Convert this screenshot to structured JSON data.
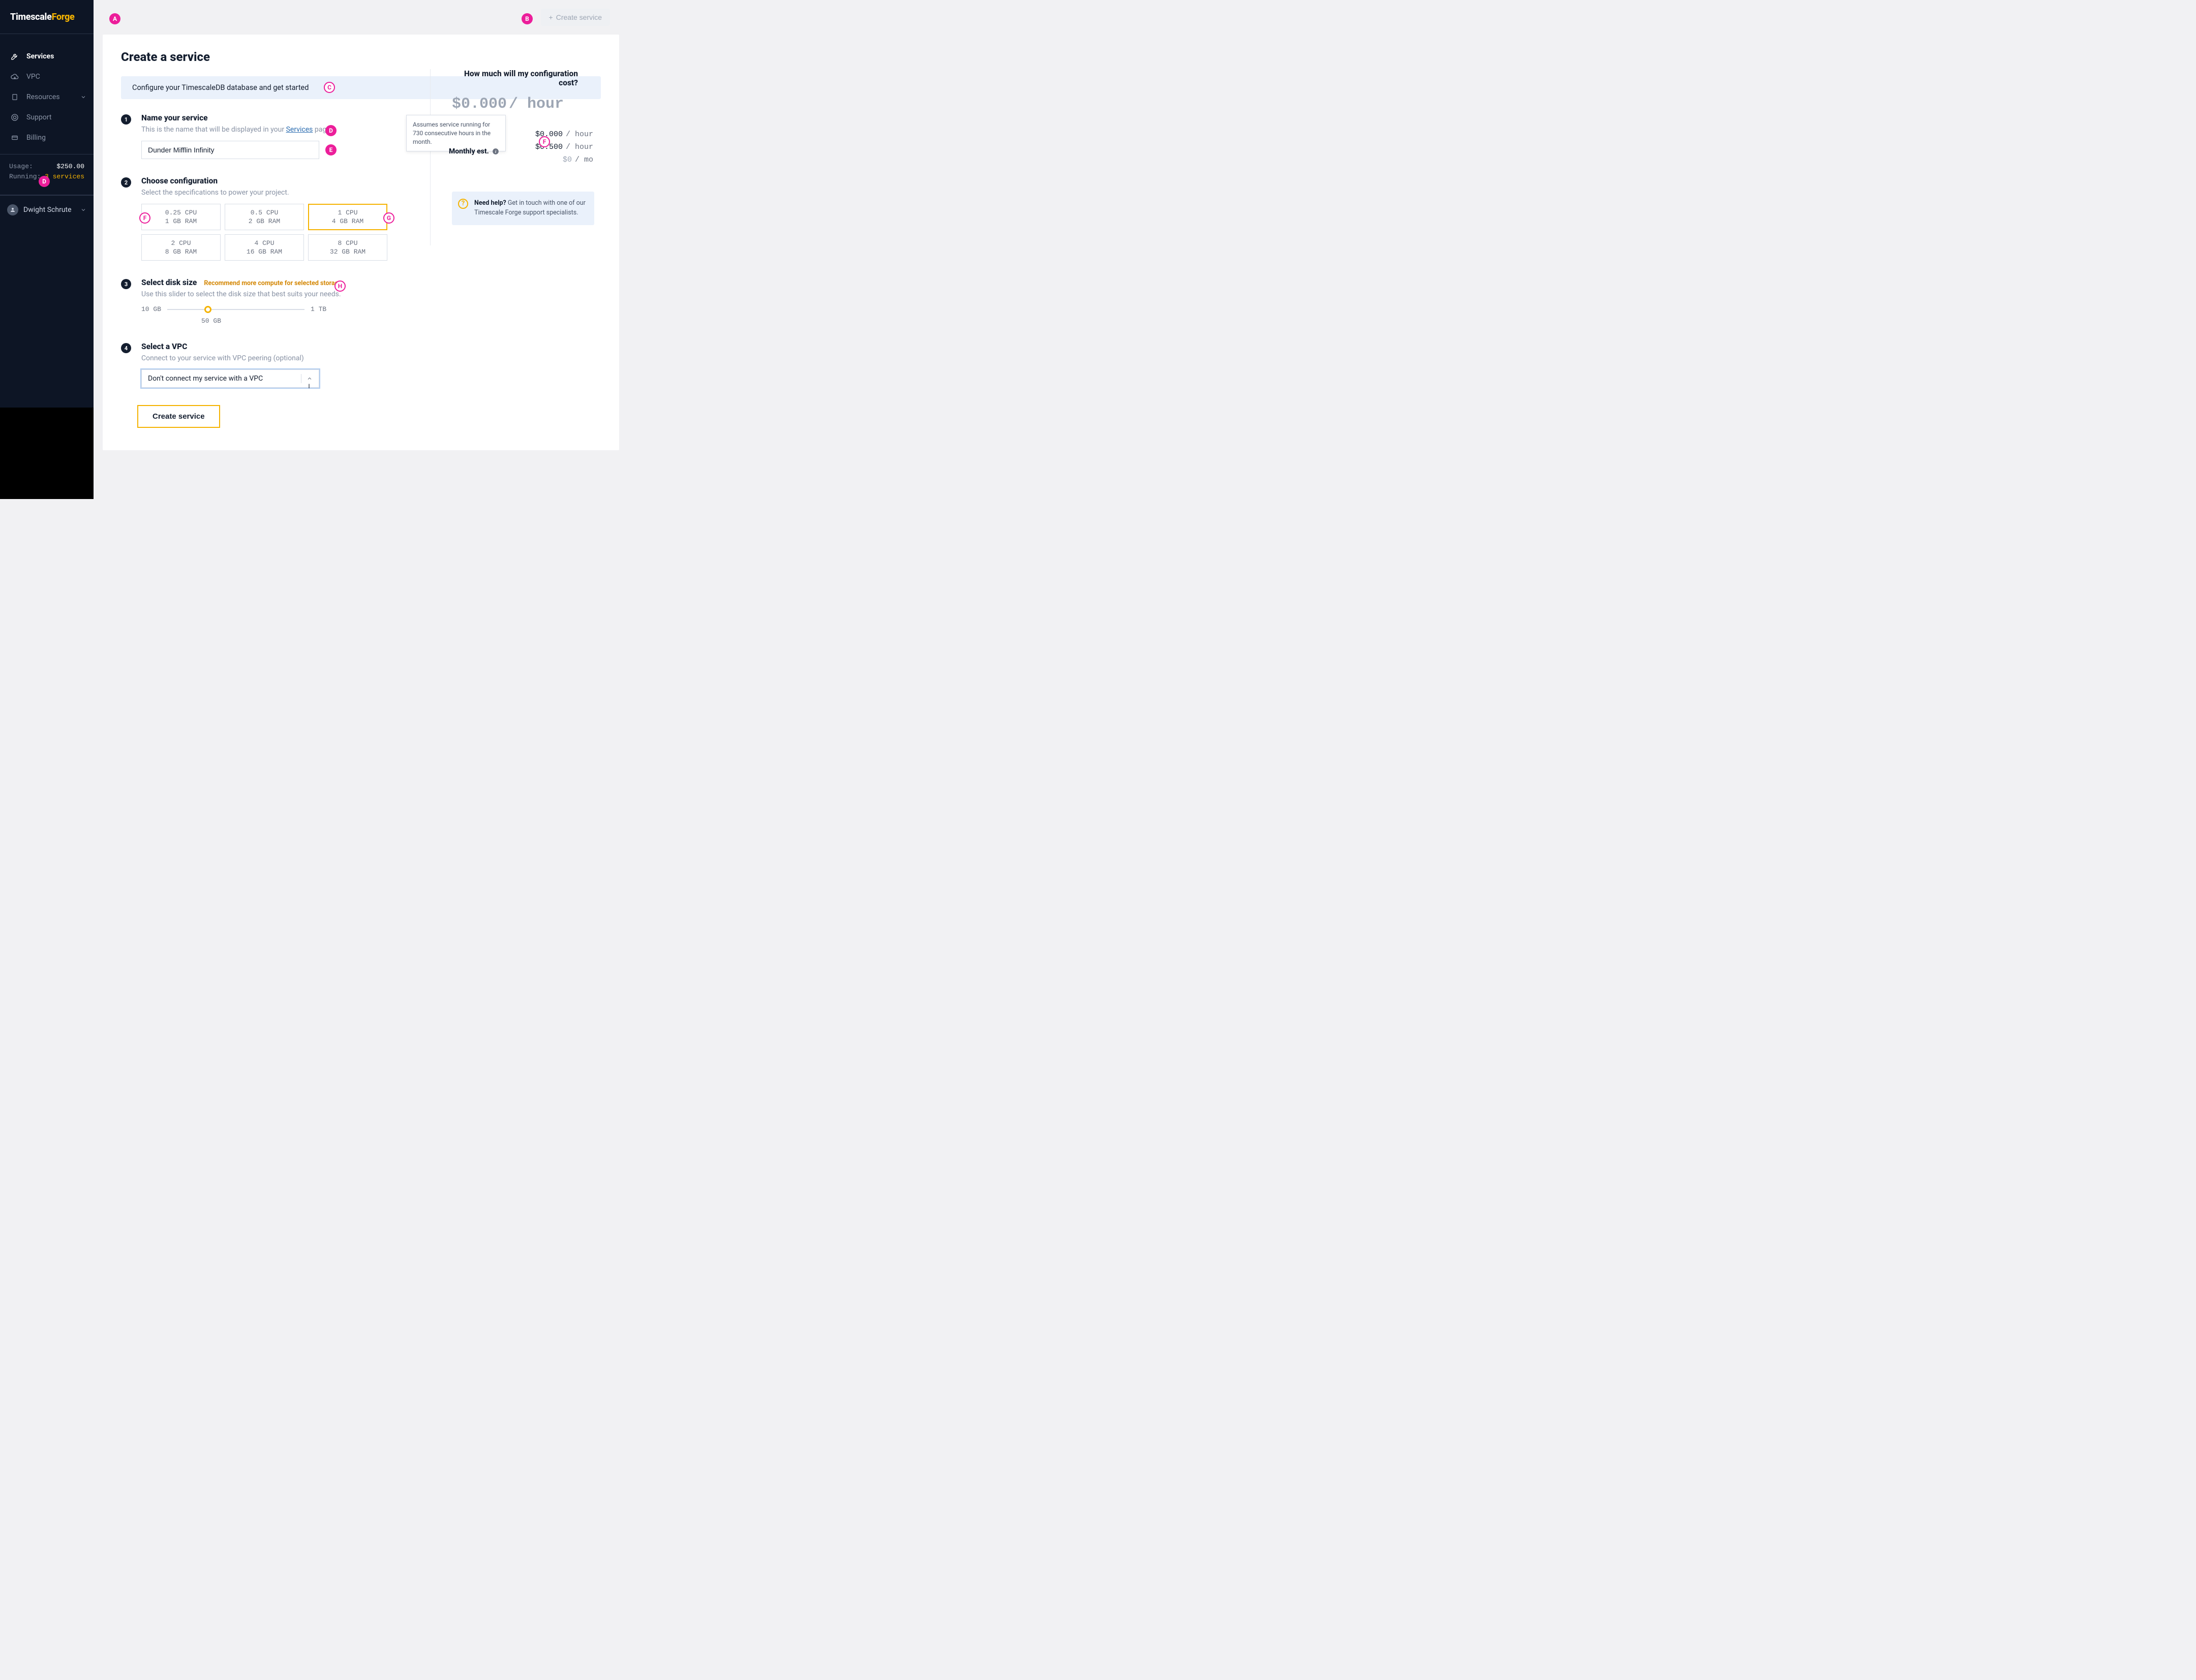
{
  "brand": {
    "part1": "Timescale",
    "part2": "Forge"
  },
  "sidebar": {
    "items": [
      {
        "label": "Services",
        "active": true
      },
      {
        "label": "VPC"
      },
      {
        "label": "Resources",
        "expandable": true
      },
      {
        "label": "Support"
      },
      {
        "label": "Billing"
      }
    ],
    "usage": {
      "label": "Usage:",
      "value": "$250.00",
      "running_label": "Running:",
      "running_value": "3 services"
    },
    "user": {
      "name": "Dwight Schrute"
    }
  },
  "topbar": {
    "create_label": "Create service"
  },
  "page": {
    "title": "Create a service",
    "banner": "Configure your TimescaleDB database and get started"
  },
  "steps": {
    "name": {
      "num": "1",
      "title": "Name your service",
      "sub_pre": "This is the name that will be displayed in your ",
      "sub_link": "Services",
      "sub_post": " page.",
      "value": "Dunder Mifflin Infinity"
    },
    "config": {
      "num": "2",
      "title": "Choose configuration",
      "sub": "Select the specifications to power your project.",
      "tiles": [
        {
          "cpu": "0.25 CPU",
          "ram": "1 GB RAM"
        },
        {
          "cpu": "0.5 CPU",
          "ram": "2 GB RAM"
        },
        {
          "cpu": "1 CPU",
          "ram": "4 GB RAM",
          "selected": true
        },
        {
          "cpu": "2 CPU",
          "ram": "8 GB RAM"
        },
        {
          "cpu": "4 CPU",
          "ram": "16 GB RAM"
        },
        {
          "cpu": "8 CPU",
          "ram": "32 GB RAM"
        }
      ]
    },
    "disk": {
      "num": "3",
      "title": "Select disk size",
      "warn": "Recommend more compute for selected storage",
      "sub": "Use this slider to select the disk size that best suits your needs.",
      "min": "10 GB",
      "max": "1 TB",
      "value": "50 GB",
      "knob_percent": 27
    },
    "vpc": {
      "num": "4",
      "title": "Select a VPC",
      "sub": "Connect to your service with VPC peering (optional)",
      "selected": "Don't connect my service with a VPC"
    }
  },
  "submit": {
    "label": "Create service"
  },
  "cost": {
    "title": "How much will my configuration cost?",
    "big_value": "$0.000",
    "big_unit": "/ hour",
    "rows": [
      {
        "val": "$0.000",
        "unit": "/ hour"
      },
      {
        "val": "$0.500",
        "unit": "/ hour"
      },
      {
        "val": "$0",
        "unit": "/ mo",
        "muted": true
      }
    ],
    "monthly_label": "Monthly est.",
    "tooltip": "Assumes service running for 730 consecutive hours in the month.",
    "help_bold": "Need help?",
    "help_text": " Get in touch with one of our Timescale Forge support specialists."
  },
  "markers": {
    "A": "A",
    "B": "B",
    "C": "C",
    "D": "D",
    "E": "E",
    "F": "F",
    "G": "G",
    "H": "H",
    "I": "I"
  }
}
